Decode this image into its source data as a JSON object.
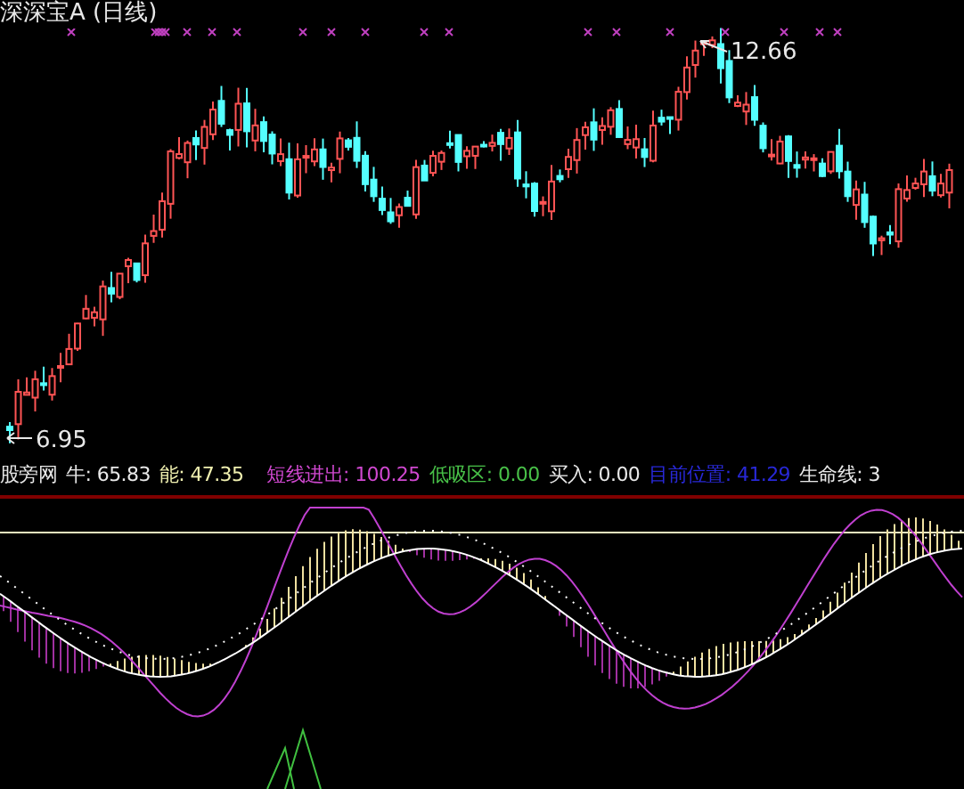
{
  "chart_title": "深深宝A (日线)",
  "price_chart": {
    "high_label": "12.66",
    "low_label": "6.95"
  },
  "indicator": {
    "name": "股旁网",
    "readings": [
      {
        "text": "牛: 65.83",
        "color": "#e8e8e8"
      },
      {
        "text": "能: 47.35",
        "color": "#f0f0b0"
      },
      {
        "text": "短线进出: 100.25",
        "color": "#d048d0"
      },
      {
        "text": "低吸区: 0.00",
        "color": "#48c048"
      },
      {
        "text": "买入: 0.00",
        "color": "#e8e8e8"
      },
      {
        "text": "目前位置: 41.29",
        "color": "#2828d8"
      },
      {
        "text": "生命线: 3",
        "color": "#e8e8e8"
      }
    ]
  }
}
